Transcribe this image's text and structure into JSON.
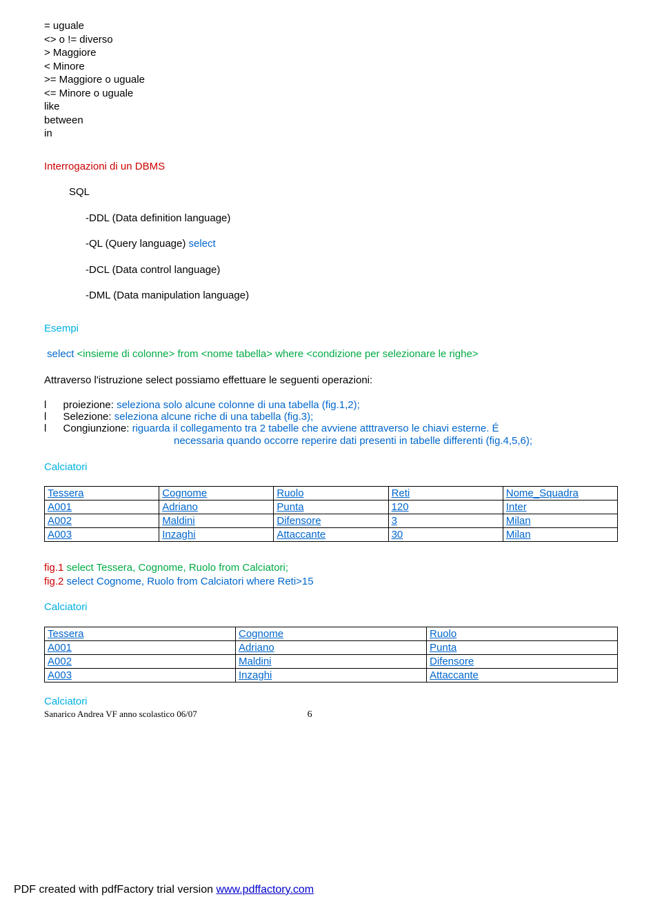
{
  "operators": {
    "eq": "=  uguale",
    "ne": "<> o !=  diverso",
    "gt": ">  Maggiore",
    "lt": "<  Minore",
    "ge": ">=  Maggiore o uguale",
    "le": " <=  Minore o uguale",
    "like": "like",
    "between": "between",
    "in": "in"
  },
  "section1": {
    "title": "Interrogazioni di un DBMS",
    "sql_label": "SQL",
    "ddl": "-DDL (Data definition language)",
    "ql_pre": "-QL (Query language) ",
    "ql_select": "select",
    "dcl": "-DCL (Data control language)",
    "dml": "-DML (Data manipulation language)"
  },
  "esempi": {
    "title": "Esempi",
    "select_keyword": "select",
    "select_body": " <insieme di colonne> from <nome tabella> where <condizione per selezionare le righe>",
    "intro": "Attraverso l'istruzione select possiamo effettuare le seguenti operazioni:",
    "li1_a": "proiezione: ",
    "li1_b": "seleziona solo alcune colonne di una tabella (fig.1,2);",
    "li2_a": "Selezione: ",
    "li2_b": "seleziona alcune riche di una tabella (fig.3);",
    "li3_a": "Congiunzione: ",
    "li3_b": "riguarda il collegamento tra 2 tabelle che avviene atttraverso le chiavi esterne. É",
    "li3_c": "necessaria quando occorre reperire dati presenti in tabelle differenti (fig.4,5,6);"
  },
  "tables": {
    "calciatori_label": "Calciatori",
    "t1": {
      "h": [
        "Tessera",
        "Cognome",
        "Ruolo",
        "Reti",
        "Nome_Squadra"
      ],
      "r1": [
        "A001",
        "Adriano",
        "Punta",
        "120",
        "Inter"
      ],
      "r2": [
        "A002",
        "Maldini",
        "Difensore",
        "3",
        "Milan"
      ],
      "r3": [
        "A003",
        "Inzaghi",
        "Attaccante",
        "30",
        "Milan"
      ]
    },
    "fig1_pre": "fig.1",
    "fig1_body": " select Tessera, Cognome, Ruolo from Calciatori;",
    "fig2_pre": "fig.2",
    "fig2_body": " select Cognome, Ruolo from Calciatori where Reti>15",
    "t2": {
      "h": [
        "Tessera",
        "Cognome",
        "Ruolo"
      ],
      "r1": [
        "A001",
        "Adriano",
        "Punta"
      ],
      "r2": [
        "A002",
        "Maldini",
        "Difensore"
      ],
      "r3": [
        "A003",
        "Inzaghi",
        "Attaccante"
      ]
    }
  },
  "footer": {
    "author": "Sanarico Andrea VF anno scolastico 06/07",
    "pagenum": "6",
    "pdf_pre": "PDF created with pdfFactory trial version ",
    "pdf_link": "www.pdffactory.com"
  }
}
